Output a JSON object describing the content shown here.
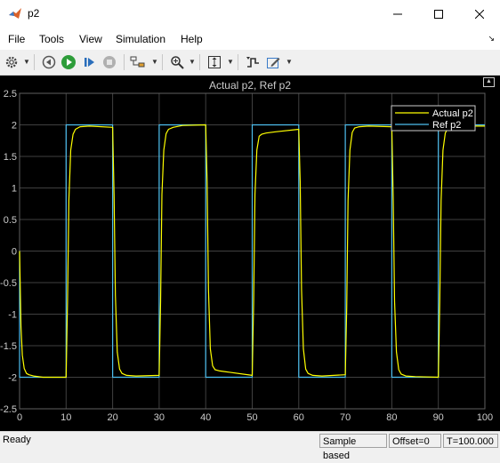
{
  "window": {
    "title": "p2"
  },
  "menu": {
    "items": [
      "File",
      "Tools",
      "View",
      "Simulation",
      "Help"
    ]
  },
  "plot": {
    "title": "Actual p2, Ref p2",
    "legend": [
      "Actual p2",
      "Ref p2"
    ]
  },
  "status": {
    "ready": "Ready",
    "sample_mode": "Sample based",
    "offset": "Offset=0",
    "time": "T=100.000"
  },
  "colors": {
    "plot_bg": "#000000",
    "grid": "#404040",
    "axis_text": "#cccccc",
    "series_actual": "#ffff00",
    "series_ref": "#4dbeee"
  },
  "chart_data": {
    "type": "line",
    "title": "Actual p2, Ref p2",
    "xlim": [
      0,
      100
    ],
    "ylim": [
      -2.5,
      2.5
    ],
    "xticks": [
      0,
      10,
      20,
      30,
      40,
      50,
      60,
      70,
      80,
      90,
      100
    ],
    "yticks": [
      -2.5,
      -2,
      -1.5,
      -1,
      -0.5,
      0,
      0.5,
      1,
      1.5,
      2,
      2.5
    ],
    "grid": true,
    "legend_position": "top-right",
    "series": [
      {
        "name": "Actual p2",
        "x": [
          0,
          0.3,
          0.6,
          1.0,
          1.5,
          2.0,
          3.0,
          5.0,
          10.0,
          10.3,
          10.6,
          11.0,
          11.5,
          12.0,
          13.0,
          15.0,
          20.0,
          20.3,
          20.6,
          21.0,
          21.5,
          22.0,
          23.0,
          25.0,
          30.0,
          30.3,
          30.6,
          31.0,
          31.5,
          32.0,
          33.0,
          35.0,
          40.0,
          40.3,
          40.6,
          41.0,
          41.5,
          42.0,
          43.0,
          45.0,
          50.0,
          50.3,
          50.6,
          51.0,
          51.5,
          52.0,
          53.0,
          55.0,
          60.0,
          60.3,
          60.6,
          61.0,
          61.5,
          62.0,
          63.0,
          65.0,
          70.0,
          70.3,
          70.6,
          71.0,
          71.5,
          72.0,
          73.0,
          75.0,
          80.0,
          80.3,
          80.6,
          81.0,
          81.5,
          82.0,
          83.0,
          85.0,
          90.0,
          90.3,
          90.6,
          91.0,
          91.5,
          92.0,
          93.0,
          95.0,
          100.0
        ],
        "y": [
          0,
          -1.2,
          -1.65,
          -1.86,
          -1.94,
          -1.96,
          -1.98,
          -2.0,
          -2.0,
          -0.8,
          0.8,
          1.6,
          1.85,
          1.93,
          1.97,
          1.98,
          1.96,
          0.9,
          -0.7,
          -1.6,
          -1.87,
          -1.94,
          -1.97,
          -1.98,
          -1.97,
          -0.8,
          0.9,
          1.6,
          1.86,
          1.93,
          1.96,
          1.99,
          2.0,
          1.1,
          -0.6,
          -1.55,
          -1.82,
          -1.88,
          -1.9,
          -1.92,
          -1.97,
          -0.8,
          0.9,
          1.6,
          1.82,
          1.85,
          1.87,
          1.89,
          1.93,
          1.1,
          -0.6,
          -1.55,
          -1.87,
          -1.94,
          -1.97,
          -1.98,
          -1.96,
          -0.9,
          0.8,
          1.6,
          1.88,
          1.95,
          1.97,
          1.98,
          1.97,
          0.8,
          -0.8,
          -1.6,
          -1.88,
          -1.95,
          -1.98,
          -1.99,
          -2.0,
          -0.8,
          0.8,
          1.6,
          1.87,
          1.94,
          1.97,
          1.98,
          1.98
        ]
      },
      {
        "name": "Ref p2",
        "x": [
          0,
          0,
          10,
          10,
          20,
          20,
          30,
          30,
          40,
          40,
          50,
          50,
          60,
          60,
          70,
          70,
          80,
          80,
          90,
          90,
          100
        ],
        "y": [
          0,
          -2,
          -2,
          2,
          2,
          -2,
          -2,
          2,
          2,
          -2,
          -2,
          2,
          2,
          -2,
          -2,
          2,
          2,
          -2,
          -2,
          2,
          2
        ]
      }
    ]
  }
}
